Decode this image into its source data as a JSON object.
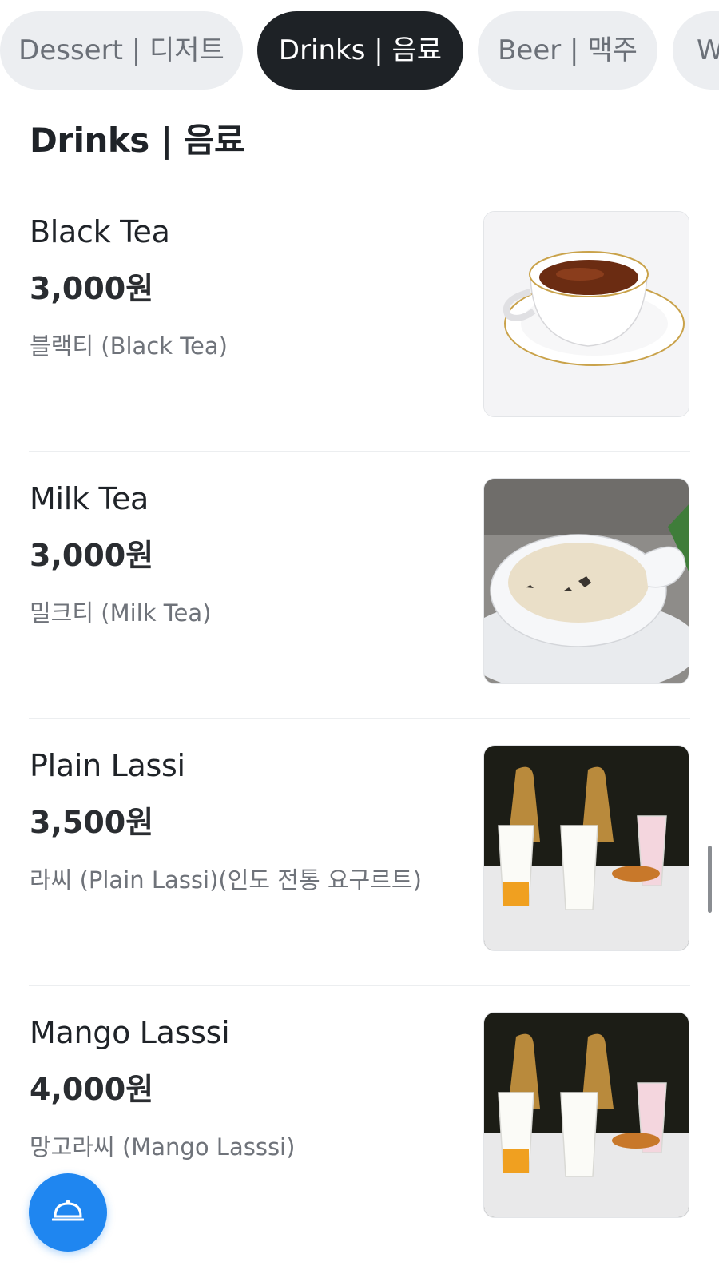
{
  "tabs": [
    {
      "label": "Dessert | 디저트",
      "active": false
    },
    {
      "label": "Drinks | 음료",
      "active": true
    },
    {
      "label": "Beer | 맥주",
      "active": false
    },
    {
      "label": "W",
      "active": false
    }
  ],
  "section": {
    "title": "Drinks | 음료"
  },
  "items": [
    {
      "name": "Black Tea",
      "price": "3,000원",
      "description": "블랙티 (Black Tea)"
    },
    {
      "name": "Milk Tea",
      "price": "3,000원",
      "description": "밀크티 (Milk Tea)"
    },
    {
      "name": "Plain Lassi",
      "price": "3,500원",
      "description": "라씨 (Plain Lassi)(인도 전통 요구르트)"
    },
    {
      "name": "Mango Lasssi",
      "price": "4,000원",
      "description": "망고라씨 (Mango Lasssi)"
    }
  ],
  "icons": {
    "add_to_cart": "cart-plus-icon",
    "fab": "service-bell-icon"
  },
  "colors": {
    "accent": "#1f86f0",
    "active_tab": "#1e2226",
    "inactive_tab": "#eceef1"
  }
}
